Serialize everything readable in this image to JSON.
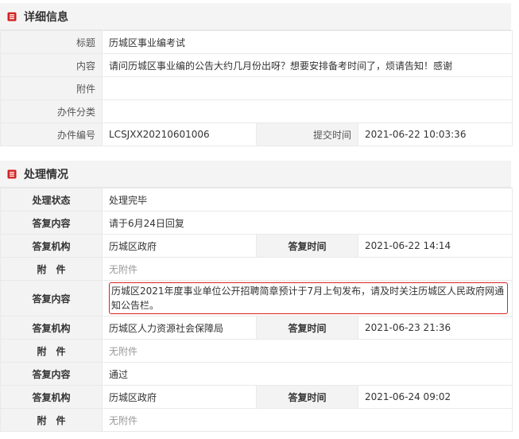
{
  "detail": {
    "title": "详细信息",
    "rows": {
      "title_label": "标题",
      "title_value": "历城区事业编考试",
      "content_label": "内容",
      "content_value": "请问历城区事业编的公告大约几月份出呀？想要安排备考时间了，烦请告知！感谢",
      "attach_label": "附件",
      "attach_value": "",
      "category_label": "办件分类",
      "category_value": "",
      "number_label": "办件编号",
      "number_value": "LCSJXX20210601006",
      "submit_label": "提交时间",
      "submit_value": "2021-06-22 10:03:36"
    }
  },
  "handling": {
    "title": "处理情况",
    "status_label": "处理状态",
    "status_value": "处理完毕",
    "replies": [
      {
        "content_label": "答复内容",
        "content": "请于6月24日回复",
        "org_label": "答复机构",
        "org": "历城区政府",
        "time_label": "答复时间",
        "time": "2021-06-22 14:14",
        "attach_label": "附　件",
        "attach": "无附件"
      },
      {
        "content_label": "答复内容",
        "content": "历城区2021年度事业单位公开招聘简章预计于7月上旬发布，请及时关注历城区人民政府网通知公告栏。",
        "org_label": "答复机构",
        "org": "历城区人力资源社会保障局",
        "time_label": "答复时间",
        "time": "2021-06-23 21:36",
        "attach_label": "附　件",
        "attach": "无附件"
      },
      {
        "content_label": "答复内容",
        "content": "通过",
        "org_label": "答复机构",
        "org": "历城区政府",
        "time_label": "答复时间",
        "time": "2021-06-24 09:02",
        "attach_label": "附　件",
        "attach": "无附件"
      }
    ]
  },
  "colors": {
    "accent": "#d22222",
    "header_bg": "#f4f4f4",
    "label_bg": "#f3f3f3"
  },
  "icons": {
    "section": "document-list-icon"
  }
}
